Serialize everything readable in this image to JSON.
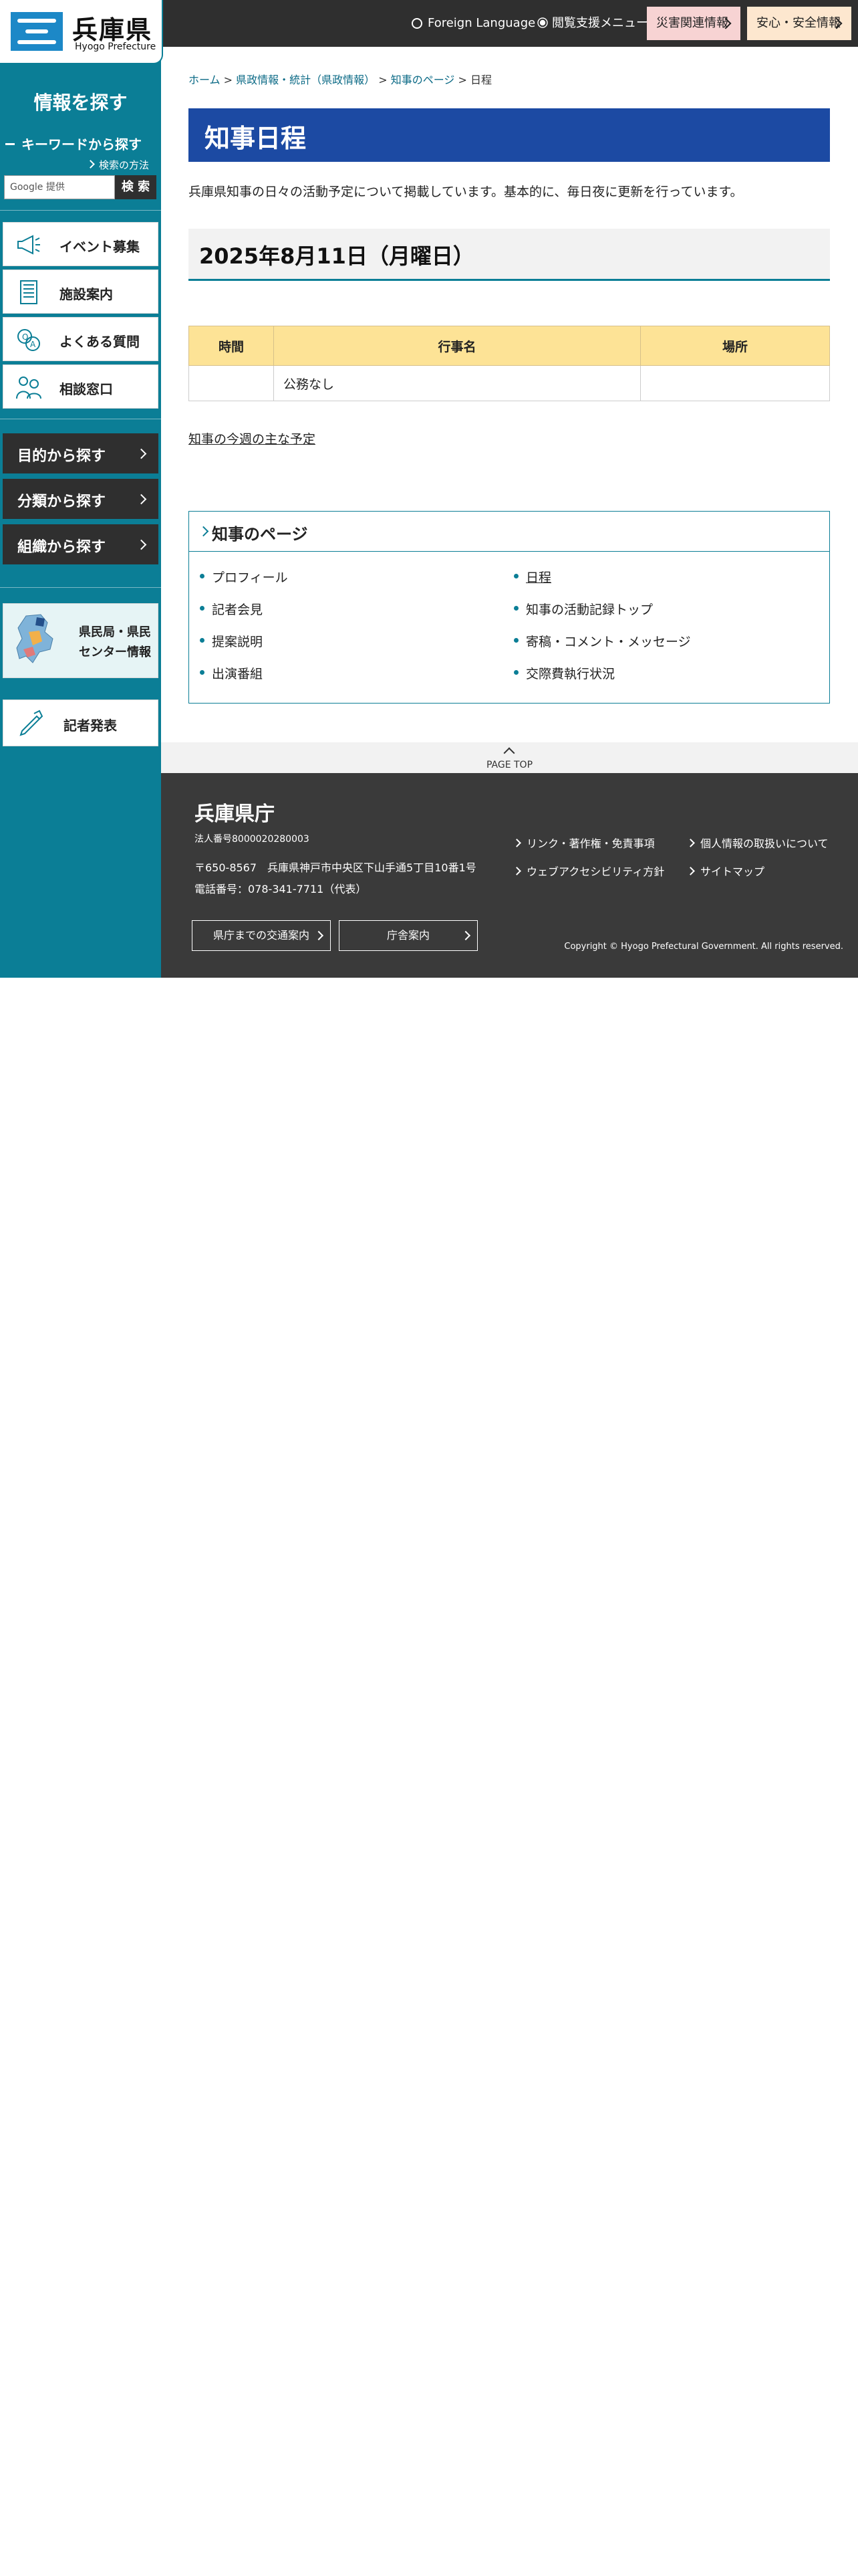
{
  "header": {
    "logo_title": "兵庫県",
    "logo_sub": "Hyogo Prefecture",
    "foreign_language": "Foreign Language",
    "accessibility_menu": "閲覧支援メニュー",
    "disaster_info": "災害関連情報",
    "safety_info": "安心・安全情報"
  },
  "sidebar": {
    "heading": "情報を探す",
    "keyword_search": "キーワードから探す",
    "search_howto": "検索の方法",
    "search_placeholder": "Google 提供",
    "search_button": "検 索",
    "cards": [
      "イベント募集",
      "施設案内",
      "よくある質問",
      "相談窓口"
    ],
    "dark_items": [
      "目的から探す",
      "分類から探す",
      "組織から探す"
    ],
    "center_info": "県民局・県民センター情報",
    "press": "記者発表"
  },
  "breadcrumb": {
    "home": "ホーム",
    "level1": "県政情報・統計（県政情報）",
    "level2": "知事のページ",
    "current": "日程",
    "sep": ">"
  },
  "main": {
    "title": "知事日程",
    "intro": "兵庫県知事の日々の活動予定について掲載しています。基本的に、毎日夜に更新を行っています。",
    "date_heading": "2025年8月11日（月曜日）",
    "table_headers": [
      "時間",
      "行事名",
      "場所"
    ],
    "table_rows": [
      [
        "",
        "公務なし",
        ""
      ]
    ],
    "week_link": "知事の今週の主な予定"
  },
  "governor_box": {
    "heading": "知事のページ",
    "items": [
      "プロフィール",
      "日程",
      "記者会見",
      "知事の活動記録トップ",
      "提案説明",
      "寄稿・コメント・メッセージ",
      "出演番組",
      "交際費執行状況"
    ]
  },
  "footer": {
    "page_top": "PAGE TOP",
    "name": "兵庫県庁",
    "corp_number": "法人番号8000020280003",
    "address": "〒650-8567　兵庫県神戸市中央区下山手通5丁目10番1号",
    "tel": "電話番号：078-341-7711（代表）",
    "btn_access": "県庁までの交通案内",
    "btn_office": "庁舎案内",
    "links": [
      "リンク・著作権・免責事項",
      "個人情報の取扱いについて",
      "ウェブアクセシビリティ方針",
      "サイトマップ"
    ],
    "copyright": "Copyright © Hyogo Prefectural Government. All rights reserved."
  },
  "colors": {
    "teal": "#0b7e96",
    "title_blue": "#1c4aa3",
    "dark": "#2f2f2f",
    "table_header": "#fde396",
    "disaster_bg": "#f7d3d3",
    "safety_bg": "#fde7cf"
  },
  "icons": {
    "event": "megaphone-icon",
    "facility": "building-icon",
    "faq": "qa-icon",
    "consult": "people-icon",
    "press": "pen-icon",
    "center": "map-icon"
  }
}
